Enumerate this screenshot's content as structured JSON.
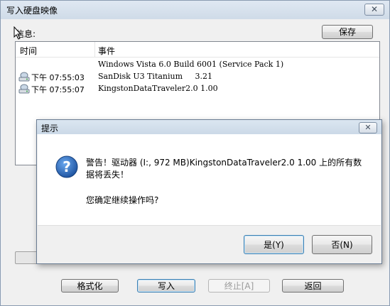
{
  "window": {
    "title": "写入硬盘映像",
    "close_label": "✕"
  },
  "info_label": "信息:",
  "save_label": "保存",
  "log": {
    "columns": [
      "时间",
      "事件"
    ],
    "rows": [
      {
        "time": "",
        "event": "Windows Vista 6.0 Build 6001 (Service Pack 1)",
        "icon": ""
      },
      {
        "time": "下午 07:55:03",
        "event": "SanDisk U3 Titanium     3.21",
        "icon": "drive-icon"
      },
      {
        "time": "下午 07:55:07",
        "event": "KingstonDataTraveler2.0 1.00",
        "icon": "drive-icon"
      }
    ]
  },
  "buttons": {
    "format": "格式化",
    "write": "写入",
    "stop": "终止[A]",
    "back": "返回"
  },
  "dialog": {
    "title": "提示",
    "close_label": "✕",
    "icon": "question-icon",
    "message_line1": "警告！驱动器 (I:, 972 MB)KingstonDataTraveler2.0 1.00 上的所有数据将丢失！",
    "message_line2": "您确定继续操作吗?",
    "yes_label": "是(Y)",
    "no_label": "否(N)"
  },
  "colors": {
    "accent": "#3c7fb1",
    "icon_blue": "#1f5fb5"
  }
}
